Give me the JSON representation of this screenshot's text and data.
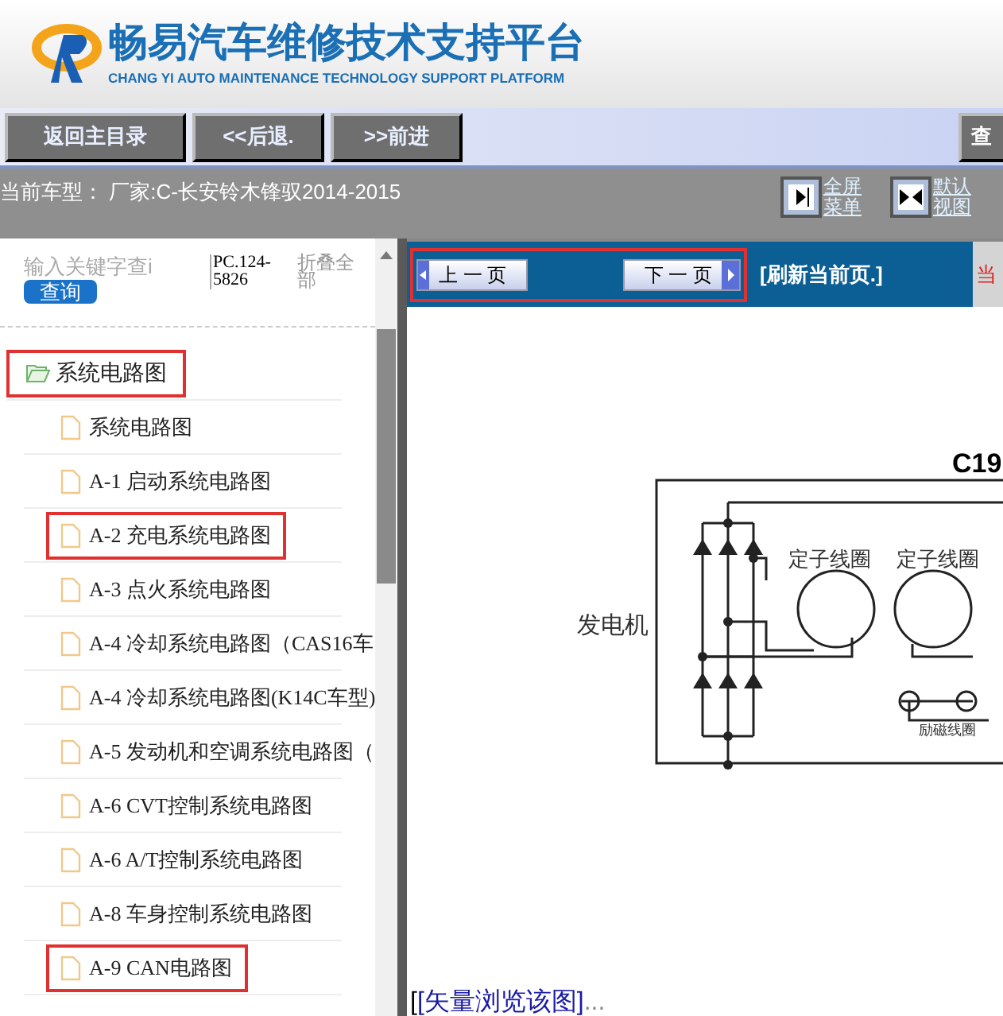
{
  "header": {
    "title": "畅易汽车维修技术支持平台",
    "subtitle": "CHANG YI AUTO MAINTENANCE TECHNOLOGY SUPPORT PLATFORM"
  },
  "toolbar": {
    "buttons": [
      "返回主目录",
      "<<后退.",
      ">>前进"
    ],
    "edge_button": "查"
  },
  "info_bar": {
    "vehicle": "当前车型： 厂家:C-长安铃木锋驭2014-2015",
    "links": [
      {
        "kind": "single",
        "label1": "全屏",
        "label2": "菜单"
      },
      {
        "kind": "double",
        "label1": "默认",
        "label2": "视图"
      }
    ]
  },
  "sidebar": {
    "search": {
      "value": "输入关键字查i",
      "button": "查询"
    },
    "code": "PC.124-5826",
    "collapse": "折叠全部",
    "tree": [
      {
        "label": "系统电路图",
        "expanded": true,
        "highlighted": true,
        "children": [
          {
            "label": "系统电路图",
            "highlighted": false
          },
          {
            "label": "A-1 启动系统电路图",
            "highlighted": false
          },
          {
            "label": "A-2 充电系统电路图",
            "highlighted": true
          },
          {
            "label": "A-3 点火系统电路图",
            "highlighted": false
          },
          {
            "label": "A-4 冷却系统电路图（CAS16车",
            "highlighted": false
          },
          {
            "label": "A-4 冷却系统电路图(K14C车型)",
            "highlighted": false
          },
          {
            "label": "A-5 发动机和空调系统电路图（",
            "highlighted": false
          },
          {
            "label": "A-6 CVT控制系统电路图",
            "highlighted": false
          },
          {
            "label": "A-6 A/T控制系统电路图",
            "highlighted": false
          },
          {
            "label": "A-8 车身控制系统电路图",
            "highlighted": false
          },
          {
            "label": "A-9 CAN电路图",
            "highlighted": true
          }
        ]
      }
    ]
  },
  "pager": {
    "prev": "上 一 页",
    "next": "下 一 页",
    "refresh": "[刷新当前页.]",
    "highlighted": true,
    "edge_text": "当"
  },
  "diagram": {
    "title": "C19",
    "labels": [
      {
        "kind": "generator",
        "text": "发电机"
      },
      {
        "kind": "stator1",
        "text": "定子线圈"
      },
      {
        "kind": "stator2",
        "text": "定子线圈"
      },
      {
        "kind": "field",
        "text": "励磁线圈"
      }
    ]
  },
  "footer": {
    "bracket": "[",
    "link": "[矢量浏览该图]",
    "ellipsis": "..."
  }
}
